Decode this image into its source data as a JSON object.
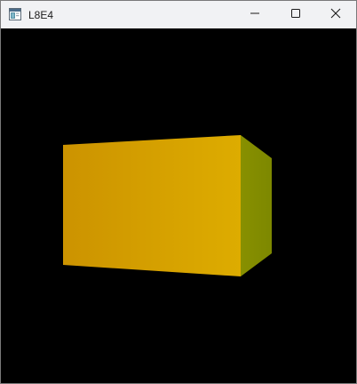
{
  "window": {
    "title": "L8E4",
    "icon": "app-window-icon",
    "controls": {
      "minimize_icon": "minimize-icon",
      "maximize_icon": "maximize-icon",
      "close_icon": "close-icon"
    }
  },
  "scene": {
    "background": "#000000",
    "colors": {
      "front_face_left": "#cc9300",
      "front_face_right": "#ddac00",
      "side_face_near": "#889000",
      "side_face_far": "#7d8800"
    }
  }
}
